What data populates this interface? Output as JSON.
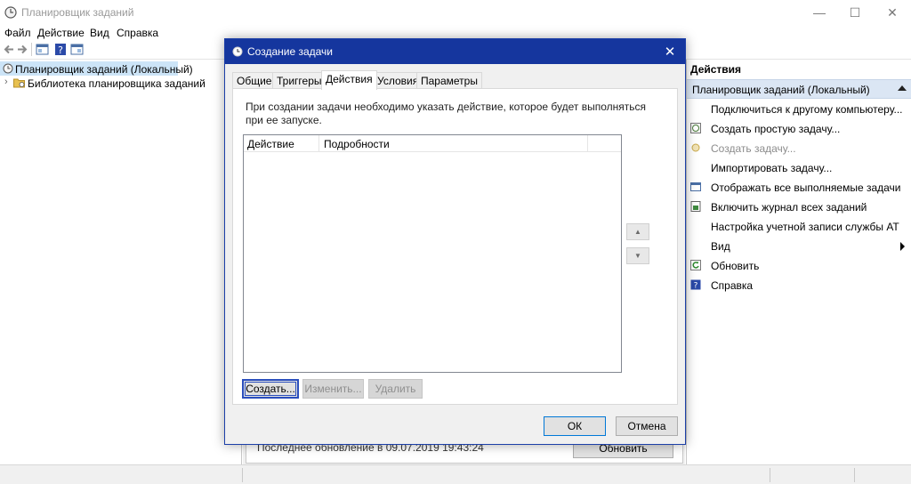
{
  "window": {
    "title": "Планировщик заданий",
    "controls": {
      "minimize": "—",
      "maximize": "☐",
      "close": "✕"
    }
  },
  "menu": [
    "Файл",
    "Действие",
    "Вид",
    "Справка"
  ],
  "tree": {
    "root": "Планировщик заданий (Локальный)",
    "child": "Библиотека планировщика заданий"
  },
  "center": {
    "last_update": "Последнее обновление в 09.07.2019 19:43:24",
    "refresh_label": "Обновить"
  },
  "actions": {
    "header": "Действия",
    "section": "Планировщик заданий (Локальный)",
    "items": [
      {
        "label": "Подключиться к другому компьютеру...",
        "icon": "none",
        "enabled": true
      },
      {
        "label": "Создать простую задачу...",
        "icon": "create-basic-task-icon",
        "enabled": true
      },
      {
        "label": "Создать задачу...",
        "icon": "create-task-icon",
        "enabled": false
      },
      {
        "label": "Импортировать задачу...",
        "icon": "none",
        "enabled": true
      },
      {
        "label": "Отображать все выполняемые задачи",
        "icon": "running-tasks-icon",
        "enabled": true
      },
      {
        "label": "Включить журнал всех заданий",
        "icon": "history-icon",
        "enabled": true
      },
      {
        "label": "Настройка учетной записи службы AT",
        "icon": "none",
        "enabled": true
      },
      {
        "label": "Вид",
        "icon": "none",
        "enabled": true,
        "submenu": true
      },
      {
        "label": "Обновить",
        "icon": "refresh-icon",
        "enabled": true
      },
      {
        "label": "Справка",
        "icon": "help-icon",
        "enabled": true
      }
    ]
  },
  "dialog": {
    "title": "Создание задачи",
    "close": "✕",
    "tabs": [
      "Общие",
      "Триггеры",
      "Действия",
      "Условия",
      "Параметры"
    ],
    "active_tab": "Действия",
    "description": "При создании задачи необходимо указать действие, которое будет выполняться при ее запуске.",
    "columns": [
      "Действие",
      "Подробности"
    ],
    "buttons": {
      "create": "Создать...",
      "edit": "Изменить...",
      "delete": "Удалить"
    },
    "move_up": "▲",
    "move_down": "▼",
    "ok": "ОК",
    "cancel": "Отмена"
  },
  "colors": {
    "dialog_title_bg": "#15369e",
    "selection_bg": "#cce4f7",
    "section_bg": "#dbe6f4"
  }
}
